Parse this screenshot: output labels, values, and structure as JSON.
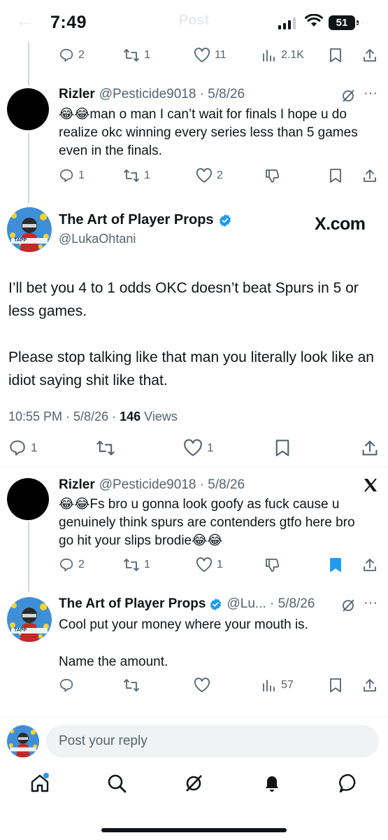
{
  "status": {
    "time": "7:49",
    "battery": "51"
  },
  "header": {
    "title": "Post"
  },
  "parent_tweet": {
    "replies": "2",
    "reposts": "1",
    "likes": "11",
    "views": "2.1K"
  },
  "reply1": {
    "name": "Rizler",
    "handle_date": "@Pesticide9018 · 5/8/26",
    "text": "😂😂man o man I can’t wait for finals I hope u do realize okc winning every series less than 5 games even in the finals.",
    "replies": "1",
    "reposts": "1",
    "likes": "2"
  },
  "main": {
    "name": "The Art of Player Props",
    "handle": "@LukaOhtani",
    "badge": "X.com",
    "avatar_text": "TAPP",
    "text_p1": "I’ll bet you 4 to 1 odds OKC doesn’t beat Spurs in 5 or less games.",
    "text_p2": "Please stop talking like that man you literally look like an idiot saying shit like that.",
    "time_date": "10:55 PM · 5/8/26 · ",
    "views_count": "146",
    "views_label": " Views",
    "replies": "1",
    "likes": "1"
  },
  "reply2": {
    "name": "Rizler",
    "handle_date": "@Pesticide9018 · 5/8/26",
    "text": "😂😂Fs bro u gonna look goofy as fuck cause u genuinely think spurs are contenders gtfo here bro go hit your slips brodie😂😂",
    "replies": "2",
    "reposts": "1",
    "likes": "1"
  },
  "reply3": {
    "name": "The Art of Player Props",
    "handle_date": "@Lu... · 5/8/26",
    "text_p1": "Cool put your money where your mouth is.",
    "text_p2": "Name the amount.",
    "views": "57"
  },
  "composer": {
    "placeholder": "Post your reply"
  },
  "colors": {
    "accent": "#1d9bf0",
    "muted": "#536471",
    "text": "#0f1419"
  }
}
